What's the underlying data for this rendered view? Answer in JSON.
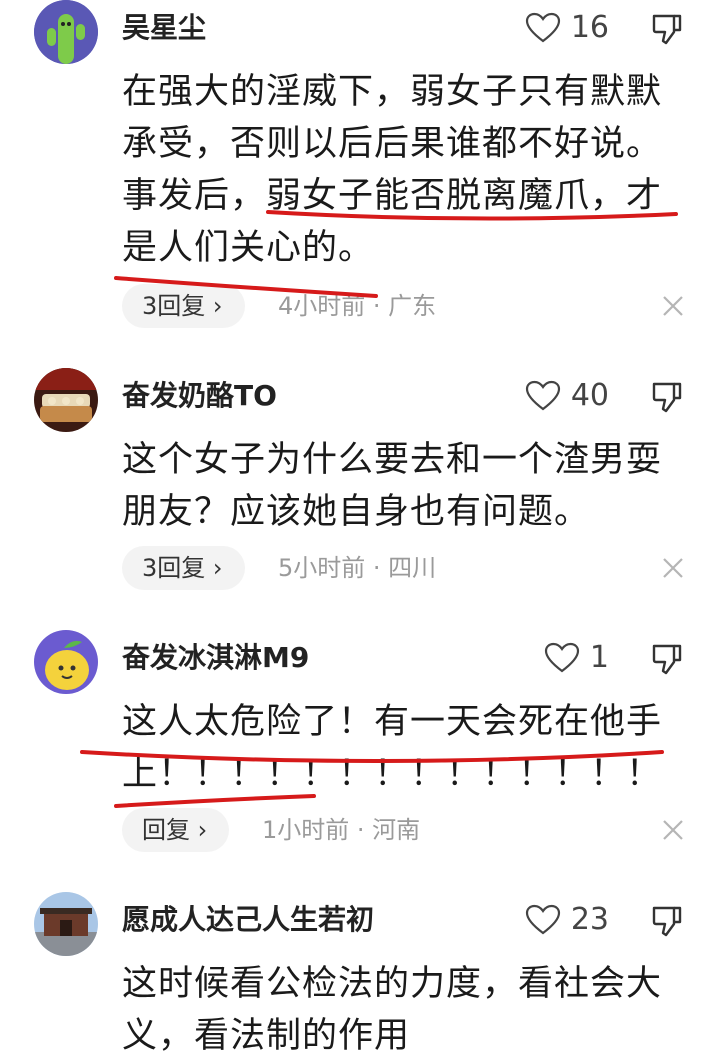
{
  "comments": [
    {
      "username": "吴星尘",
      "likes": "16",
      "text": "在强大的淫威下，弱女子只有默默承受，否则以后后果谁都不好说。事发后，弱女子能否脱离魔爪，才是人们关心的。",
      "reply_label": "3回复",
      "meta": "4小时前 · 广东",
      "avatar": "cactus-avatar"
    },
    {
      "username": "奋发奶酪TO",
      "likes": "40",
      "text": "这个女子为什么要去和一个渣男耍朋友？应该她自身也有问题。",
      "reply_label": "3回复",
      "meta": "5小时前 · 四川",
      "avatar": "photo-avatar"
    },
    {
      "username": "奋发冰淇淋M9",
      "likes": "1",
      "text": "这人太危险了！有一天会死在他手上！！！！！！！！！！！！！！",
      "reply_label": "回复",
      "meta": "1小时前 · 河南",
      "avatar": "lemon-avatar"
    },
    {
      "username": "愿成人达己人生若初",
      "likes": "23",
      "text": "这时候看公检法的力度，看社会大义，看法制的作用",
      "avatar": "building-avatar"
    }
  ],
  "colors": {
    "underline": "#d61a1a",
    "pill_bg": "#f3f3f3",
    "meta": "#9a9a9a"
  }
}
